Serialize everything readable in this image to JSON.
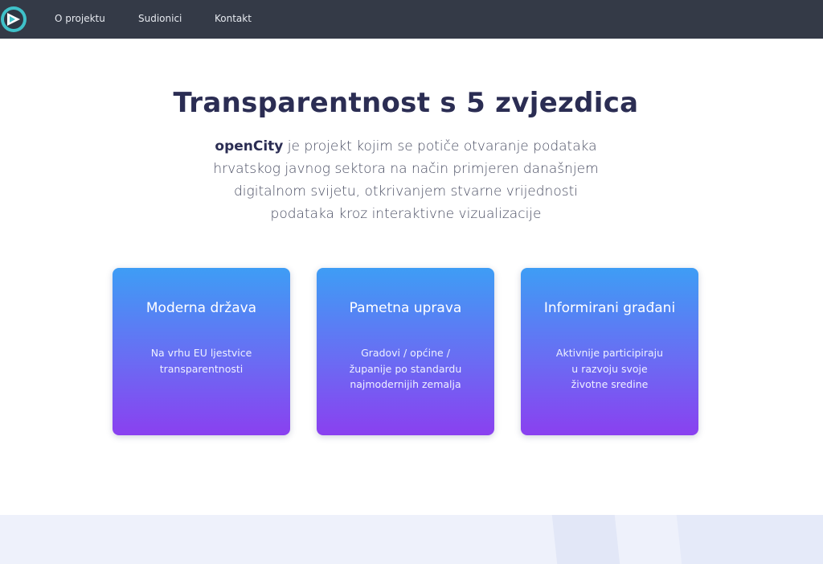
{
  "nav": {
    "logo_icon": "opencity-logo-icon",
    "links": [
      "O projektu",
      "Sudionici",
      "Kontakt"
    ],
    "bg_color": "#343a47"
  },
  "hero": {
    "title": "Transparentnost s 5 zvjezdica",
    "brand": "openCity",
    "description": " je projekt kojim se potiče otvaranje podataka hrvatskog javnog sektora na način primjeren današnjem digitalnom svijetu, otkrivanjem stvarne vrijednosti podataka kroz interaktivne vizualizacije"
  },
  "cards": [
    {
      "title": "Moderna država",
      "lines": [
        "Na vrhu EU ljestvice",
        "transparentnosti"
      ]
    },
    {
      "title": "Pametna uprava",
      "lines": [
        "Gradovi / općine /",
        "županije po standardu",
        "najmodernijih zemalja"
      ]
    },
    {
      "title": "Informirani građani",
      "lines": [
        "Aktivnije participiraju",
        "u razvoju svoje",
        "životne sredine"
      ]
    }
  ],
  "colors": {
    "title": "#2b2d53",
    "card_gradient_top": "#3e9df5",
    "card_gradient_bottom": "#8a40f0"
  }
}
